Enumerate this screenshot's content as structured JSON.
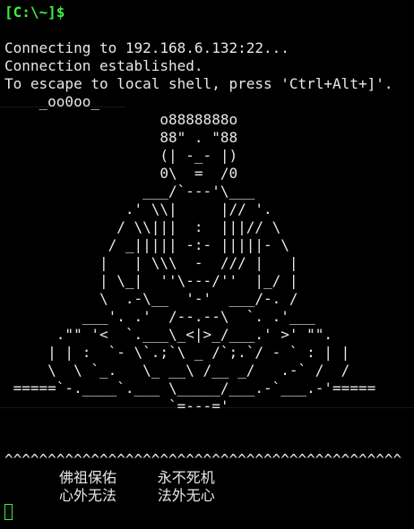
{
  "terminal": {
    "prompt": "[C:\\~]$",
    "connecting": "Connecting to 192.168.6.132:22...",
    "established": "Connection established.",
    "escape_hint": "To escape to local shell, press 'Ctrl+Alt+]'.",
    "banner": [
      "    _oo0oo_",
      "                  o8888888o",
      "                  88\" . \"88",
      "                  (| -_- |)",
      "                  0\\  =  /0",
      "                ___/`---'\\___",
      "              .' \\\\|     |// '.",
      "             / \\\\|||  :  |||// \\",
      "            / _||||| -:- |||||- \\",
      "           |   | \\\\\\  -  /// |   |",
      "           | \\_|  ''\\---/''  |_/ |",
      "           \\  .-\\__  '-'  ___/-. /",
      "         ___'. .'  /--.--\\  `. .'___",
      "      .\"\" '<  `.___\\_<|>_/___.' >' \"\".",
      "     | | :  `- \\`.;`\\ _ /`;.`/ - ` : | |",
      "     \\  \\ `_.   \\_ __\\ /__ _/   .-` /  /",
      " =====`-.____`.___ \\_____/___.-`___.-'=====",
      "                   `=---='"
    ],
    "separator": "^^^^^^^^^^^^^^^^^^^^^^^^^^^^^^^^^^^^^^^^^^^^^^",
    "blessing_line1": "            佛祖保佑         永不死机",
    "blessing_line2": "            心外无法         法外无心"
  },
  "colors": {
    "background": "#000000",
    "text": "#e8e8e8",
    "prompt": "#3cf040",
    "cursor": "#3cf040"
  }
}
